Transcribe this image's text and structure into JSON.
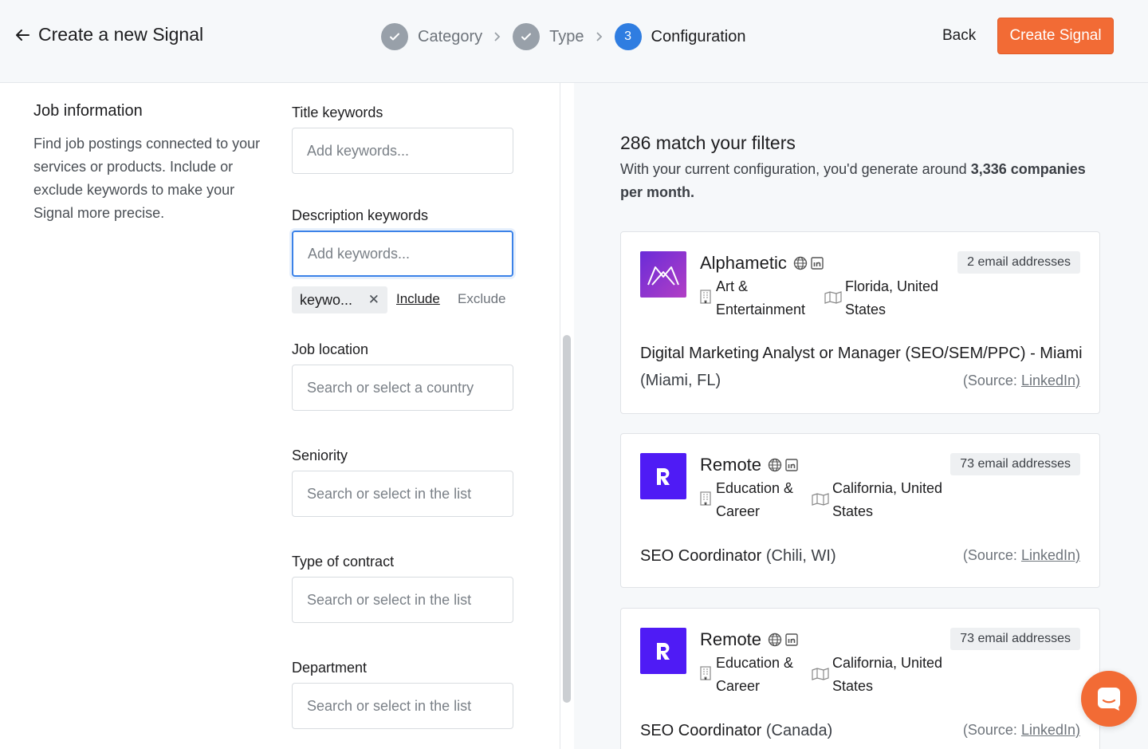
{
  "header": {
    "title": "Create a new Signal",
    "steps": [
      {
        "label": "Category",
        "state": "done"
      },
      {
        "label": "Type",
        "state": "done"
      },
      {
        "label": "Configuration",
        "state": "active",
        "number": "3"
      }
    ],
    "back_label": "Back",
    "create_label": "Create Signal"
  },
  "left": {
    "section_title": "Job information",
    "section_desc": "Find job postings connected to your services or products. Include or exclude keywords to make your Signal more precise.",
    "fields": {
      "title_keywords": {
        "label": "Title keywords",
        "placeholder": "Add keywords..."
      },
      "description_keywords": {
        "label": "Description keywords",
        "placeholder": "Add keywords..."
      },
      "job_location": {
        "label": "Job location",
        "placeholder": "Search or select a country"
      },
      "seniority": {
        "label": "Seniority",
        "placeholder": "Search or select in the list"
      },
      "contract": {
        "label": "Type of contract",
        "placeholder": "Search or select in the list"
      },
      "department": {
        "label": "Department",
        "placeholder": "Search or select in the list"
      }
    },
    "tag": {
      "text": "keywo...",
      "remove": "✕"
    },
    "include_label": "Include",
    "exclude_label": "Exclude"
  },
  "right": {
    "match_title": "286 match your filters",
    "match_desc_prefix": "With your current configuration, you'd generate around ",
    "match_desc_bold": "3,336 companies per month.",
    "source_prefix": "(Source: ",
    "source_link": "LinkedIn)",
    "cards": [
      {
        "company": "Alphametic",
        "emails": "2 email addresses",
        "industry": "Art & Entertainment",
        "location": "Florida, United States",
        "job_title": "Digital Marketing Analyst or Manager (SEO/SEM/PPC) - Miami",
        "job_location": "(Miami, FL)"
      },
      {
        "company": "Remote",
        "emails": "73 email addresses",
        "industry": "Education & Career",
        "location": "California, United States",
        "job_title": "SEO Coordinator",
        "job_location": "(Chili, WI)"
      },
      {
        "company": "Remote",
        "emails": "73 email addresses",
        "industry": "Education & Career",
        "location": "California, United States",
        "job_title": "SEO Coordinator",
        "job_location": "(Canada)"
      }
    ]
  },
  "colors": {
    "accent": "#f26b35",
    "active_step": "#2f7de1",
    "done_step": "#98a0a9"
  }
}
